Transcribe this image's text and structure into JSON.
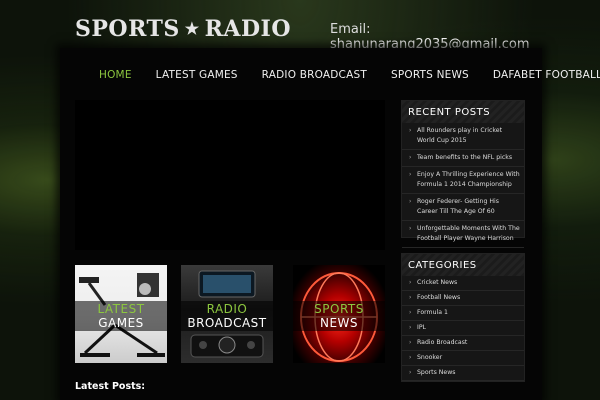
{
  "header": {
    "logo_left": "SPORTS",
    "logo_star": "★",
    "logo_right": "RADIO",
    "email_label": "Email:",
    "email_value": "shanunarang2035@gmail.com"
  },
  "nav": {
    "items": [
      {
        "label": "HOME",
        "active": true
      },
      {
        "label": "LATEST GAMES",
        "active": false
      },
      {
        "label": "RADIO BROADCAST",
        "active": false
      },
      {
        "label": "SPORTS NEWS",
        "active": false
      },
      {
        "label": "DAFABET FOOTBALL",
        "active": false
      }
    ]
  },
  "tiles": [
    {
      "line1": "LATEST",
      "line2": "GAMES"
    },
    {
      "line1": "RADIO",
      "line2": "BROADCAST"
    },
    {
      "line1": "SPORTS",
      "line2": "NEWS"
    }
  ],
  "main": {
    "latest_posts_label": "Latest Posts:"
  },
  "sidebar": {
    "recent_posts_title": "RECENT POSTS",
    "recent_posts": [
      "All Rounders play in Cricket World Cup 2015",
      "Team benefits to the NFL picks",
      "Enjoy A Thrilling Experience With Formula 1 2014 Championship",
      "Roger Federer- Getting His Career Till The Age Of 60",
      "Unforgettable Moments With The Football Player Wayne Harrison"
    ],
    "categories_title": "CATEGORIES",
    "categories": [
      "Cricket News",
      "Football News",
      "Formula 1",
      "IPL",
      "Radio Broadcast",
      "Snooker",
      "Sports News"
    ]
  },
  "colors": {
    "accent": "#8cc63f",
    "panel": "#050505",
    "sidebar_box": "#161616"
  }
}
